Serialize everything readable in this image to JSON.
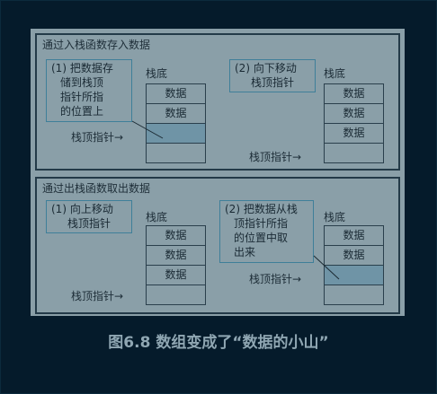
{
  "diagram": {
    "push_panel": {
      "title": "通过入栈函数存入数据",
      "note1": [
        "(1) 把数据存",
        "储到栈顶",
        "指针所指",
        "的位置上"
      ],
      "note2": [
        "(2) 向下移动",
        "栈顶指针"
      ],
      "stack_bottom_label": "栈底",
      "cell_label": "数据",
      "pointer_label": "栈顶指针→"
    },
    "pop_panel": {
      "title": "通过出栈函数取出数据",
      "note1": [
        "(1) 向上移动",
        "栈顶指针"
      ],
      "note2": [
        "(2) 把数据从栈",
        "顶指针所指",
        "的位置中取",
        "出来"
      ],
      "stack_bottom_label": "栈底",
      "cell_label": "数据",
      "pointer_label": "栈顶指针→"
    }
  },
  "caption": "图6.8 数组变成了“数据的小山”",
  "colors": {
    "background": "#051b2b",
    "figure": "#8a9fa8",
    "highlight_cell": "#6f94a6",
    "note_border": "#3f7f99",
    "caption": "#8fa6b2"
  }
}
